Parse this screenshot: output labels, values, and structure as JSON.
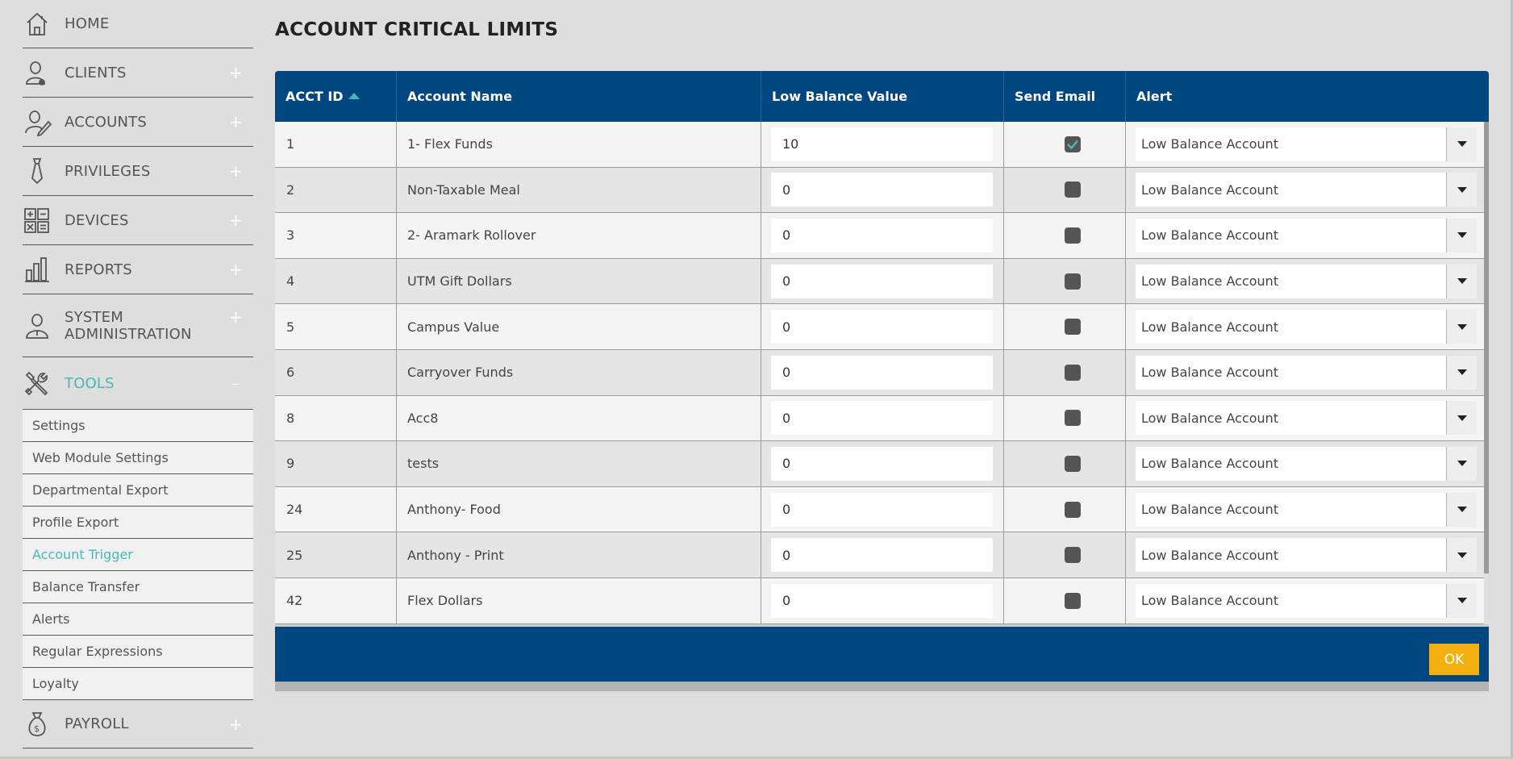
{
  "sidebar": {
    "items": [
      {
        "label": "HOME",
        "icon": "house-icon"
      },
      {
        "label": "CLIENTS",
        "icon": "person-icon",
        "toggle": "+"
      },
      {
        "label": "ACCOUNTS",
        "icon": "person-edit-icon",
        "toggle": "+"
      },
      {
        "label": "PRIVILEGES",
        "icon": "tie-icon",
        "toggle": "+"
      },
      {
        "label": "DEVICES",
        "icon": "calculator-icon",
        "toggle": "+"
      },
      {
        "label": "REPORTS",
        "icon": "bar-chart-icon",
        "toggle": "+"
      },
      {
        "label": "SYSTEM ADMINISTRATION",
        "icon": "admin-person-icon",
        "toggle": "+"
      },
      {
        "label": "TOOLS",
        "icon": "tools-icon",
        "toggle": "–"
      },
      {
        "label": "PAYROLL",
        "icon": "money-bag-icon",
        "toggle": "+"
      }
    ],
    "tools_sub": [
      "Settings",
      "Web Module Settings",
      "Departmental Export",
      "Profile Export",
      "Account Trigger",
      "Balance Transfer",
      "Alerts",
      "Regular Expressions",
      "Loyalty"
    ],
    "active_sub": "Account Trigger",
    "accent_color": "#4bb6b7"
  },
  "page": {
    "title": "ACCOUNT CRITICAL LIMITS"
  },
  "grid": {
    "header_color": "#004680",
    "columns": [
      "ACCT ID",
      "Account Name",
      "Low Balance Value",
      "Send Email",
      "Alert"
    ],
    "sort": {
      "column": "ACCT ID",
      "direction": "ascending"
    },
    "rows": [
      {
        "id": "1",
        "name": "1- Flex Funds",
        "low_balance": "10",
        "send_email": true,
        "alert": "Low Balance Account"
      },
      {
        "id": "2",
        "name": "Non-Taxable Meal",
        "low_balance": "0",
        "send_email": false,
        "alert": "Low Balance Account"
      },
      {
        "id": "3",
        "name": "2- Aramark Rollover",
        "low_balance": "0",
        "send_email": false,
        "alert": "Low Balance Account"
      },
      {
        "id": "4",
        "name": "UTM Gift Dollars",
        "low_balance": "0",
        "send_email": false,
        "alert": "Low Balance Account"
      },
      {
        "id": "5",
        "name": "Campus Value",
        "low_balance": "0",
        "send_email": false,
        "alert": "Low Balance Account"
      },
      {
        "id": "6",
        "name": "Carryover Funds",
        "low_balance": "0",
        "send_email": false,
        "alert": "Low Balance Account"
      },
      {
        "id": "8",
        "name": "Acc8",
        "low_balance": "0",
        "send_email": false,
        "alert": "Low Balance Account"
      },
      {
        "id": "9",
        "name": "tests",
        "low_balance": "0",
        "send_email": false,
        "alert": "Low Balance Account"
      },
      {
        "id": "24",
        "name": "Anthony- Food",
        "low_balance": "0",
        "send_email": false,
        "alert": "Low Balance Account"
      },
      {
        "id": "25",
        "name": "Anthony - Print",
        "low_balance": "0",
        "send_email": false,
        "alert": "Low Balance Account"
      },
      {
        "id": "42",
        "name": "Flex Dollars",
        "low_balance": "0",
        "send_email": false,
        "alert": "Low Balance Account"
      }
    ],
    "ok_label": "OK",
    "ok_color": "#f3b010"
  }
}
